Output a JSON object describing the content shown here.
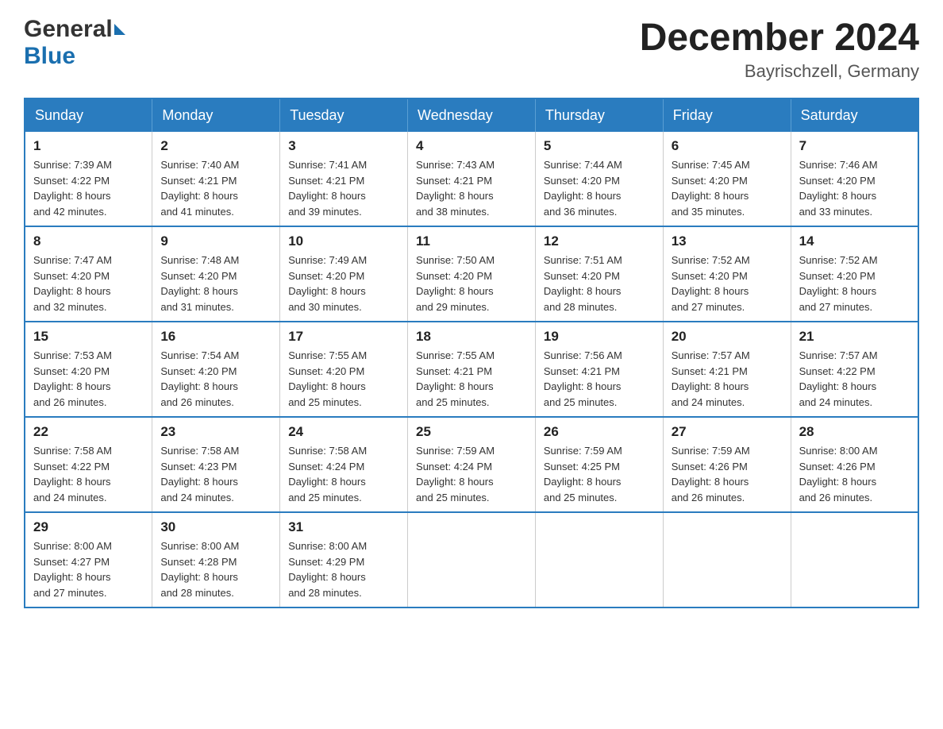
{
  "header": {
    "month_year": "December 2024",
    "location": "Bayrischzell, Germany",
    "logo_general": "General",
    "logo_blue": "Blue"
  },
  "weekdays": [
    "Sunday",
    "Monday",
    "Tuesday",
    "Wednesday",
    "Thursday",
    "Friday",
    "Saturday"
  ],
  "weeks": [
    [
      {
        "day": "1",
        "sunrise": "Sunrise: 7:39 AM",
        "sunset": "Sunset: 4:22 PM",
        "daylight": "Daylight: 8 hours",
        "minutes": "and 42 minutes."
      },
      {
        "day": "2",
        "sunrise": "Sunrise: 7:40 AM",
        "sunset": "Sunset: 4:21 PM",
        "daylight": "Daylight: 8 hours",
        "minutes": "and 41 minutes."
      },
      {
        "day": "3",
        "sunrise": "Sunrise: 7:41 AM",
        "sunset": "Sunset: 4:21 PM",
        "daylight": "Daylight: 8 hours",
        "minutes": "and 39 minutes."
      },
      {
        "day": "4",
        "sunrise": "Sunrise: 7:43 AM",
        "sunset": "Sunset: 4:21 PM",
        "daylight": "Daylight: 8 hours",
        "minutes": "and 38 minutes."
      },
      {
        "day": "5",
        "sunrise": "Sunrise: 7:44 AM",
        "sunset": "Sunset: 4:20 PM",
        "daylight": "Daylight: 8 hours",
        "minutes": "and 36 minutes."
      },
      {
        "day": "6",
        "sunrise": "Sunrise: 7:45 AM",
        "sunset": "Sunset: 4:20 PM",
        "daylight": "Daylight: 8 hours",
        "minutes": "and 35 minutes."
      },
      {
        "day": "7",
        "sunrise": "Sunrise: 7:46 AM",
        "sunset": "Sunset: 4:20 PM",
        "daylight": "Daylight: 8 hours",
        "minutes": "and 33 minutes."
      }
    ],
    [
      {
        "day": "8",
        "sunrise": "Sunrise: 7:47 AM",
        "sunset": "Sunset: 4:20 PM",
        "daylight": "Daylight: 8 hours",
        "minutes": "and 32 minutes."
      },
      {
        "day": "9",
        "sunrise": "Sunrise: 7:48 AM",
        "sunset": "Sunset: 4:20 PM",
        "daylight": "Daylight: 8 hours",
        "minutes": "and 31 minutes."
      },
      {
        "day": "10",
        "sunrise": "Sunrise: 7:49 AM",
        "sunset": "Sunset: 4:20 PM",
        "daylight": "Daylight: 8 hours",
        "minutes": "and 30 minutes."
      },
      {
        "day": "11",
        "sunrise": "Sunrise: 7:50 AM",
        "sunset": "Sunset: 4:20 PM",
        "daylight": "Daylight: 8 hours",
        "minutes": "and 29 minutes."
      },
      {
        "day": "12",
        "sunrise": "Sunrise: 7:51 AM",
        "sunset": "Sunset: 4:20 PM",
        "daylight": "Daylight: 8 hours",
        "minutes": "and 28 minutes."
      },
      {
        "day": "13",
        "sunrise": "Sunrise: 7:52 AM",
        "sunset": "Sunset: 4:20 PM",
        "daylight": "Daylight: 8 hours",
        "minutes": "and 27 minutes."
      },
      {
        "day": "14",
        "sunrise": "Sunrise: 7:52 AM",
        "sunset": "Sunset: 4:20 PM",
        "daylight": "Daylight: 8 hours",
        "minutes": "and 27 minutes."
      }
    ],
    [
      {
        "day": "15",
        "sunrise": "Sunrise: 7:53 AM",
        "sunset": "Sunset: 4:20 PM",
        "daylight": "Daylight: 8 hours",
        "minutes": "and 26 minutes."
      },
      {
        "day": "16",
        "sunrise": "Sunrise: 7:54 AM",
        "sunset": "Sunset: 4:20 PM",
        "daylight": "Daylight: 8 hours",
        "minutes": "and 26 minutes."
      },
      {
        "day": "17",
        "sunrise": "Sunrise: 7:55 AM",
        "sunset": "Sunset: 4:20 PM",
        "daylight": "Daylight: 8 hours",
        "minutes": "and 25 minutes."
      },
      {
        "day": "18",
        "sunrise": "Sunrise: 7:55 AM",
        "sunset": "Sunset: 4:21 PM",
        "daylight": "Daylight: 8 hours",
        "minutes": "and 25 minutes."
      },
      {
        "day": "19",
        "sunrise": "Sunrise: 7:56 AM",
        "sunset": "Sunset: 4:21 PM",
        "daylight": "Daylight: 8 hours",
        "minutes": "and 25 minutes."
      },
      {
        "day": "20",
        "sunrise": "Sunrise: 7:57 AM",
        "sunset": "Sunset: 4:21 PM",
        "daylight": "Daylight: 8 hours",
        "minutes": "and 24 minutes."
      },
      {
        "day": "21",
        "sunrise": "Sunrise: 7:57 AM",
        "sunset": "Sunset: 4:22 PM",
        "daylight": "Daylight: 8 hours",
        "minutes": "and 24 minutes."
      }
    ],
    [
      {
        "day": "22",
        "sunrise": "Sunrise: 7:58 AM",
        "sunset": "Sunset: 4:22 PM",
        "daylight": "Daylight: 8 hours",
        "minutes": "and 24 minutes."
      },
      {
        "day": "23",
        "sunrise": "Sunrise: 7:58 AM",
        "sunset": "Sunset: 4:23 PM",
        "daylight": "Daylight: 8 hours",
        "minutes": "and 24 minutes."
      },
      {
        "day": "24",
        "sunrise": "Sunrise: 7:58 AM",
        "sunset": "Sunset: 4:24 PM",
        "daylight": "Daylight: 8 hours",
        "minutes": "and 25 minutes."
      },
      {
        "day": "25",
        "sunrise": "Sunrise: 7:59 AM",
        "sunset": "Sunset: 4:24 PM",
        "daylight": "Daylight: 8 hours",
        "minutes": "and 25 minutes."
      },
      {
        "day": "26",
        "sunrise": "Sunrise: 7:59 AM",
        "sunset": "Sunset: 4:25 PM",
        "daylight": "Daylight: 8 hours",
        "minutes": "and 25 minutes."
      },
      {
        "day": "27",
        "sunrise": "Sunrise: 7:59 AM",
        "sunset": "Sunset: 4:26 PM",
        "daylight": "Daylight: 8 hours",
        "minutes": "and 26 minutes."
      },
      {
        "day": "28",
        "sunrise": "Sunrise: 8:00 AM",
        "sunset": "Sunset: 4:26 PM",
        "daylight": "Daylight: 8 hours",
        "minutes": "and 26 minutes."
      }
    ],
    [
      {
        "day": "29",
        "sunrise": "Sunrise: 8:00 AM",
        "sunset": "Sunset: 4:27 PM",
        "daylight": "Daylight: 8 hours",
        "minutes": "and 27 minutes."
      },
      {
        "day": "30",
        "sunrise": "Sunrise: 8:00 AM",
        "sunset": "Sunset: 4:28 PM",
        "daylight": "Daylight: 8 hours",
        "minutes": "and 28 minutes."
      },
      {
        "day": "31",
        "sunrise": "Sunrise: 8:00 AM",
        "sunset": "Sunset: 4:29 PM",
        "daylight": "Daylight: 8 hours",
        "minutes": "and 28 minutes."
      },
      null,
      null,
      null,
      null
    ]
  ]
}
